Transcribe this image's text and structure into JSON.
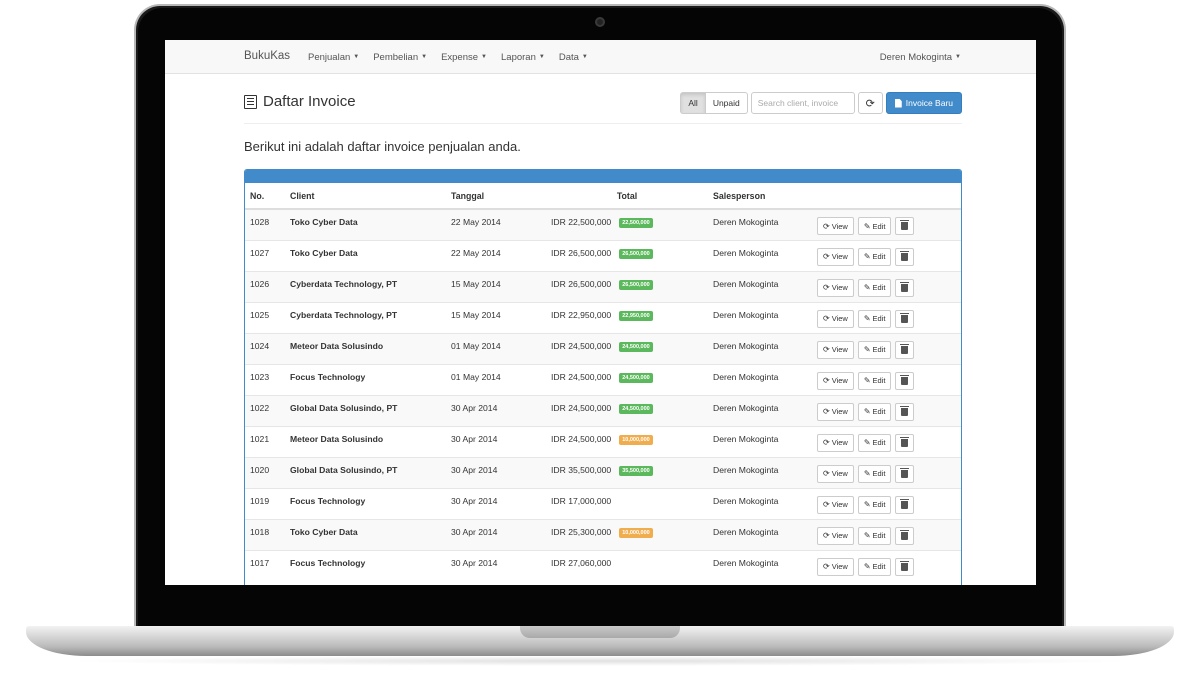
{
  "navbar": {
    "brand": "BukuKas",
    "menu": [
      {
        "label": "Penjualan"
      },
      {
        "label": "Pembelian"
      },
      {
        "label": "Expense"
      },
      {
        "label": "Laporan"
      },
      {
        "label": "Data"
      }
    ],
    "user": "Deren Mokoginta"
  },
  "header": {
    "title": "Daftar Invoice",
    "filter_all": "All",
    "filter_unpaid": "Unpaid",
    "search_placeholder": "Search client, invoice",
    "new_invoice_label": "Invoice Baru"
  },
  "lead_text": "Berikut ini adalah daftar invoice penjualan anda.",
  "table": {
    "columns": {
      "no": "No.",
      "client": "Client",
      "date": "Tanggal",
      "total": "Total",
      "salesperson": "Salesperson"
    },
    "action_labels": {
      "view": "View",
      "edit": "Edit"
    },
    "rows": [
      {
        "no": "1028",
        "client": "Toko Cyber Data",
        "date": "22 May 2014",
        "total": "IDR 22,500,000",
        "badge": "22,500,000",
        "badge_color": "#5cb85c",
        "salesperson": "Deren Mokoginta"
      },
      {
        "no": "1027",
        "client": "Toko Cyber Data",
        "date": "22 May 2014",
        "total": "IDR 26,500,000",
        "badge": "26,500,000",
        "badge_color": "#5cb85c",
        "salesperson": "Deren Mokoginta"
      },
      {
        "no": "1026",
        "client": "Cyberdata Technology, PT",
        "date": "15 May 2014",
        "total": "IDR 26,500,000",
        "badge": "26,500,000",
        "badge_color": "#5cb85c",
        "salesperson": "Deren Mokoginta"
      },
      {
        "no": "1025",
        "client": "Cyberdata Technology, PT",
        "date": "15 May 2014",
        "total": "IDR 22,950,000",
        "badge": "22,950,000",
        "badge_color": "#5cb85c",
        "salesperson": "Deren Mokoginta"
      },
      {
        "no": "1024",
        "client": "Meteor Data Solusindo",
        "date": "01 May 2014",
        "total": "IDR 24,500,000",
        "badge": "24,500,000",
        "badge_color": "#5cb85c",
        "salesperson": "Deren Mokoginta"
      },
      {
        "no": "1023",
        "client": "Focus Technology",
        "date": "01 May 2014",
        "total": "IDR 24,500,000",
        "badge": "24,500,000",
        "badge_color": "#5cb85c",
        "salesperson": "Deren Mokoginta"
      },
      {
        "no": "1022",
        "client": "Global Data Solusindo, PT",
        "date": "30 Apr 2014",
        "total": "IDR 24,500,000",
        "badge": "24,500,000",
        "badge_color": "#5cb85c",
        "salesperson": "Deren Mokoginta"
      },
      {
        "no": "1021",
        "client": "Meteor Data Solusindo",
        "date": "30 Apr 2014",
        "total": "IDR 24,500,000",
        "badge": "10,000,000",
        "badge_color": "#f0ad4e",
        "salesperson": "Deren Mokoginta"
      },
      {
        "no": "1020",
        "client": "Global Data Solusindo, PT",
        "date": "30 Apr 2014",
        "total": "IDR 35,500,000",
        "badge": "35,500,000",
        "badge_color": "#5cb85c",
        "salesperson": "Deren Mokoginta"
      },
      {
        "no": "1019",
        "client": "Focus Technology",
        "date": "30 Apr 2014",
        "total": "IDR 17,000,000",
        "badge": "",
        "badge_color": "",
        "salesperson": "Deren Mokoginta"
      },
      {
        "no": "1018",
        "client": "Toko Cyber Data",
        "date": "30 Apr 2014",
        "total": "IDR 25,300,000",
        "badge": "10,000,000",
        "badge_color": "#f0ad4e",
        "salesperson": "Deren Mokoginta"
      },
      {
        "no": "1017",
        "client": "Focus Technology",
        "date": "30 Apr 2014",
        "total": "IDR 27,060,000",
        "badge": "",
        "badge_color": "",
        "salesperson": "Deren Mokoginta"
      }
    ]
  },
  "colors": {
    "primary": "#428bca",
    "paid": "#5cb85c",
    "partial": "#f0ad4e"
  }
}
